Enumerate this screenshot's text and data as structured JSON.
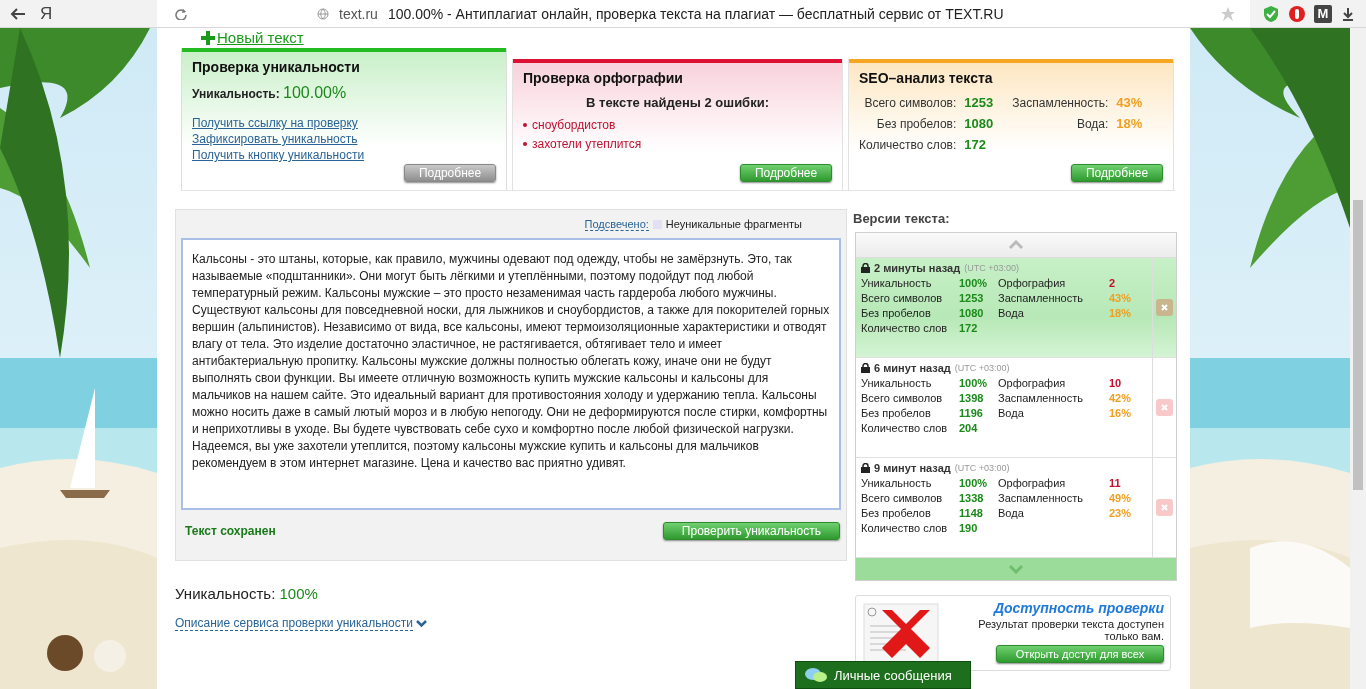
{
  "browser": {
    "logo": "Я",
    "url": "text.ru",
    "title": "100.00% - Антиплагиат онлайн, проверка текста на плагиат — бесплатный сервис от TEXT.RU",
    "extension_badge": "M"
  },
  "new_text_link": "Новый текст",
  "panels": [
    {
      "kind": "uniqueness",
      "selected": true,
      "color": "#22bb22",
      "title": "Проверка уникальности",
      "label": "Уникальность:",
      "value": "100.00%",
      "links": [
        "Получить ссылку на проверку",
        "Зафиксировать уникальность",
        "Получить кнопку уникальности"
      ],
      "button": "Подробнее"
    },
    {
      "kind": "spelling",
      "selected": false,
      "color": "#dd1133",
      "title": "Проверка орфографии",
      "summary": "В тексте найдены 2 ошибки:",
      "errors": [
        "сноубордистов",
        "захотели утеплится"
      ],
      "button": "Подробнее"
    },
    {
      "kind": "seo",
      "selected": false,
      "color": "#f5a623",
      "title": "SEO–анализ текста",
      "stats": [
        {
          "label": "Всего символов:",
          "value": "1253",
          "kind": "good"
        },
        {
          "label": "Заспамленность:",
          "value": "43%",
          "kind": "warn"
        },
        {
          "label": "Без пробелов:",
          "value": "1080",
          "kind": "good"
        },
        {
          "label": "Вода:",
          "value": "18%",
          "kind": "warn"
        },
        {
          "label": "Количество слов:",
          "value": "172",
          "kind": "good"
        }
      ],
      "button": "Подробнее"
    }
  ],
  "editor": {
    "highlight_link": "Подсвечено:",
    "legend": "Неуникальные фрагменты",
    "text": "Кальсоны - это штаны, которые, как правило, мужчины одевают под одежду, чтобы не замёрзнуть. Это, так называемые «подштанники». Они могут быть лёгкими и утеплёнными, поэтому подойдут под любой температурный режим. Кальсоны мужские – это просто незаменимая часть гардероба любого мужчины. Существуют кальсоны для повседневной носки, для лыжников и сноубордистов, а также для покорителей горных вершин (альпинистов). Независимо от вида, все кальсоны, имеют термоизоляционные характеристики и отводят влагу от тела. Это изделие достаточно эластичное, не растягивается, обтягивает тело и имеет антибактериальную пропитку. Кальсоны мужские должны полностью облегать кожу, иначе они не будут выполнять свои функции. Вы имеете отличную возможность купить мужские кальсоны и кальсоны для мальчиков на нашем сайте. Это идеальный вариант для противостояния холоду и удержанию тепла. Кальсоны можно носить даже в самый лютый мороз и в любую непогоду. Они не деформируются после стирки, комфортны и неприхотливы в уходе. Вы будете чувствовать себе сухо и комфортно после любой физической нагрузки. Надеемся, вы уже захотели утеплится, поэтому кальсоны мужские купить и кальсоны для мальчиков рекомендуем в этом интернет магазине. Цена и качество вас приятно удивят.",
    "status": "Текст сохранен",
    "button": "Проверить уникальность"
  },
  "result": {
    "label": "Уникальность:",
    "value": "100%",
    "description_link": "Описание сервиса проверки уникальности"
  },
  "versions": {
    "title": "Версии текста:",
    "items": [
      {
        "selected": true,
        "time": "2 минуты назад",
        "timezone": "(UTC +03:00)",
        "stats": [
          {
            "label": "Уникальность",
            "value": "100%",
            "kind": "good"
          },
          {
            "label": "Орфография",
            "value": "2",
            "kind": "error"
          },
          {
            "label": "Всего символов",
            "value": "1253",
            "kind": "good"
          },
          {
            "label": "Заспамленность",
            "value": "43%",
            "kind": "warn"
          },
          {
            "label": "Без пробелов",
            "value": "1080",
            "kind": "good"
          },
          {
            "label": "Вода",
            "value": "18%",
            "kind": "warn"
          },
          {
            "label": "Количество слов",
            "value": "172",
            "kind": "good"
          }
        ]
      },
      {
        "selected": false,
        "time": "6 минут назад",
        "timezone": "(UTC +03:00)",
        "stats": [
          {
            "label": "Уникальность",
            "value": "100%",
            "kind": "good"
          },
          {
            "label": "Орфография",
            "value": "10",
            "kind": "error"
          },
          {
            "label": "Всего символов",
            "value": "1398",
            "kind": "good"
          },
          {
            "label": "Заспамленность",
            "value": "42%",
            "kind": "warn"
          },
          {
            "label": "Без пробелов",
            "value": "1196",
            "kind": "good"
          },
          {
            "label": "Вода",
            "value": "16%",
            "kind": "warn"
          },
          {
            "label": "Количество слов",
            "value": "204",
            "kind": "good"
          }
        ]
      },
      {
        "selected": false,
        "time": "9 минут назад",
        "timezone": "(UTC +03:00)",
        "stats": [
          {
            "label": "Уникальность",
            "value": "100%",
            "kind": "good"
          },
          {
            "label": "Орфография",
            "value": "11",
            "kind": "error"
          },
          {
            "label": "Всего символов",
            "value": "1338",
            "kind": "good"
          },
          {
            "label": "Заспамленность",
            "value": "49%",
            "kind": "warn"
          },
          {
            "label": "Без пробелов",
            "value": "1148",
            "kind": "good"
          },
          {
            "label": "Вода",
            "value": "23%",
            "kind": "warn"
          },
          {
            "label": "Количество слов",
            "value": "190",
            "kind": "good"
          }
        ]
      }
    ]
  },
  "access": {
    "title": "Доступность проверки",
    "text": "Результат проверки текста доступен только вам.",
    "button": "Открыть доступ для всех"
  },
  "chat": {
    "label": "Личные сообщения"
  }
}
